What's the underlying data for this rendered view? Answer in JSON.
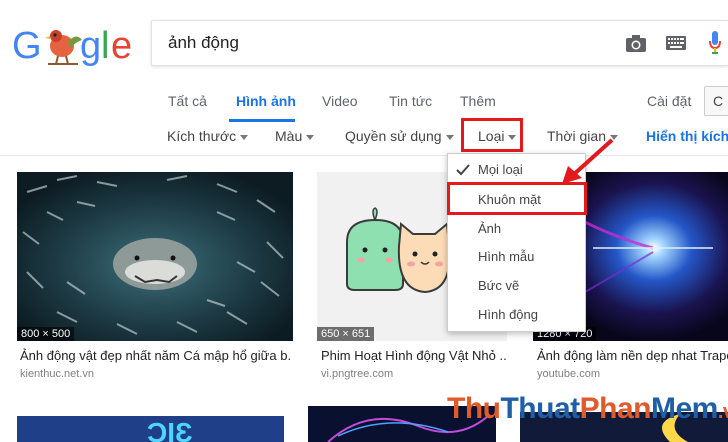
{
  "search": {
    "query": "ảnh động"
  },
  "tabs": [
    {
      "label": "Tất cả"
    },
    {
      "label": "Hình ảnh",
      "active": true
    },
    {
      "label": "Video"
    },
    {
      "label": "Tin tức"
    },
    {
      "label": "Thêm"
    }
  ],
  "header": {
    "settings": "Cài đặt",
    "tools": "C"
  },
  "filters": [
    {
      "label": "Kích thước"
    },
    {
      "label": "Màu"
    },
    {
      "label": "Quyền sử dụng"
    },
    {
      "label": "Loại"
    },
    {
      "label": "Thời gian"
    }
  ],
  "show_sizes": "Hiển thị kích",
  "dropdown": {
    "items": [
      {
        "label": "Mọi loại",
        "checked": true
      },
      {
        "label": "Khuôn mặt",
        "highlighted": true
      },
      {
        "label": "Ảnh"
      },
      {
        "label": "Hình mẫu"
      },
      {
        "label": "Bức vẽ"
      },
      {
        "label": "Hình động"
      }
    ]
  },
  "results": [
    {
      "dims": "800 × 500",
      "caption": "Ảnh động vật đẹp nhất năm Cá mập hổ giữa b...",
      "source": "kienthuc.net.vn"
    },
    {
      "dims": "650 × 651",
      "caption": "Phim Hoạt Hình động Vật Nhỏ ...",
      "source": "vi.pngtree.com"
    },
    {
      "dims": "1280 × 720",
      "caption": "Ảnh động làm nền dẹp nhat Trapco",
      "source": "youtube.com"
    }
  ],
  "watermark": {
    "part1": "Thu",
    "part2": "Thuat",
    "part3": "Phan",
    "part4": "Mem",
    "part5": ".vn"
  },
  "colors": {
    "accent": "#1a73e8",
    "highlight_red": "#e3191c"
  }
}
